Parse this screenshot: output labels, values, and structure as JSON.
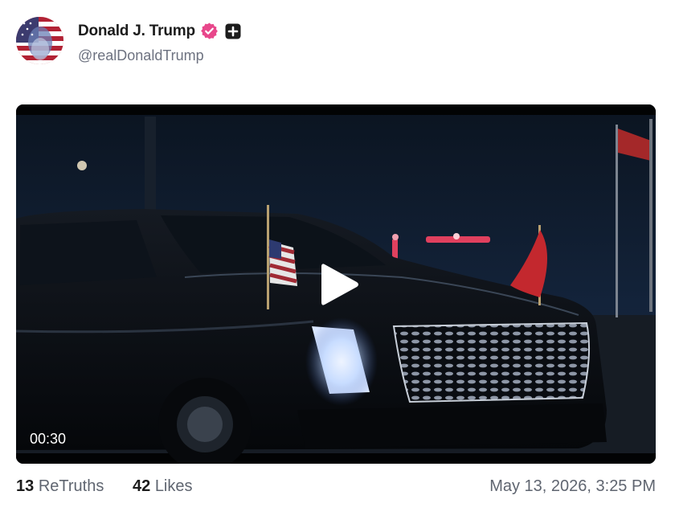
{
  "post": {
    "author_name": "Donald J. Trump",
    "handle": "@realDonaldTrump",
    "verified_icon": "verified-badge-icon",
    "plus_icon": "plus-square-icon",
    "avatar_icon": "profile-avatar"
  },
  "video": {
    "duration": "00:30",
    "play_icon": "play-icon"
  },
  "stats": {
    "retruths_count": "13",
    "retruths_label": "ReTruths",
    "likes_count": "42",
    "likes_label": "Likes",
    "timestamp": "May 13, 2026, 3:25 PM"
  },
  "colors": {
    "verified": "#e8478b",
    "text_primary": "#1c1c1c",
    "text_secondary": "#5f6570"
  }
}
